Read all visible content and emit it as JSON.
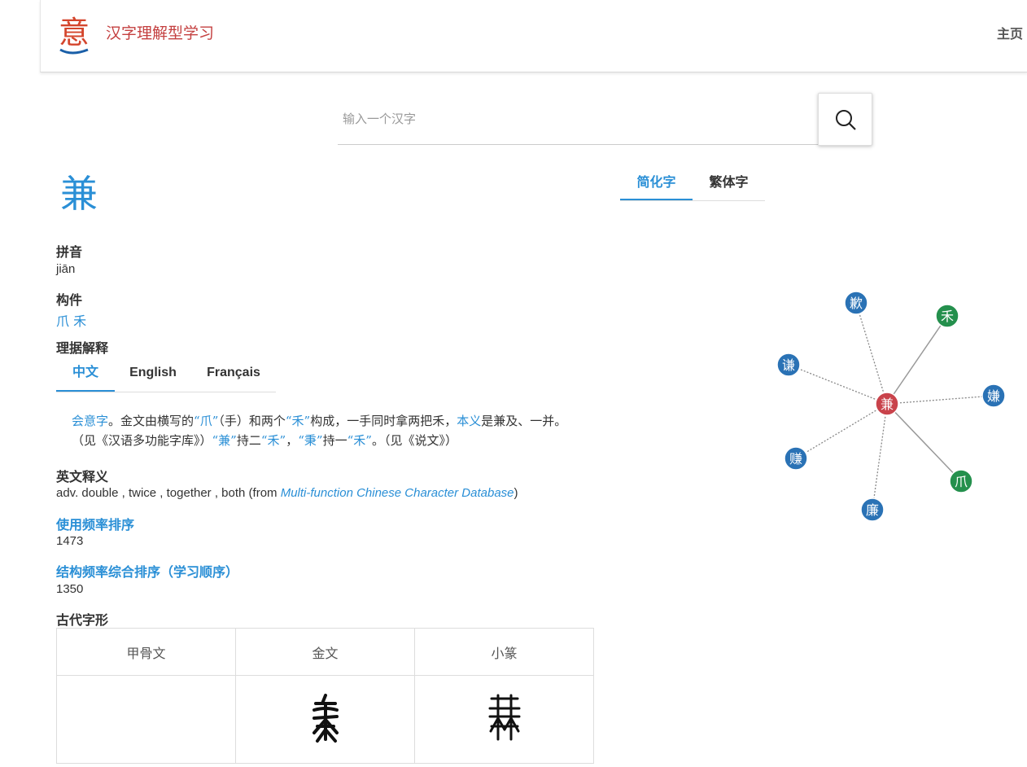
{
  "header": {
    "logo_char": "意",
    "site_title": "汉字理解型学习",
    "home_label": "主页"
  },
  "search": {
    "placeholder": "输入一个汉字"
  },
  "character": {
    "glyph": "兼",
    "pinyin_label": "拼音",
    "pinyin": "jiān",
    "components_label": "构件",
    "components": [
      "爪",
      "禾"
    ],
    "explanation_label": "理据解释",
    "lang_tabs": [
      "中文",
      "English",
      "Français"
    ],
    "explanation": {
      "t1": "会意字",
      "t2": "。金文由横写的",
      "t3": "“爪”",
      "t4": "（手）和两个",
      "t5": "“禾”",
      "t6": "构成，一手同时拿两把禾，",
      "t7": "本义",
      "t8": "是兼及、一并。（见《汉语多功能字库》）",
      "t9": "“兼”",
      "t10": "持二",
      "t11": "“禾”",
      "t12": "，",
      "t13": "“秉”",
      "t14": "持一",
      "t15": "“禾”",
      "t16": "。（见《说文》）"
    },
    "english_label": "英文释义",
    "english_text": "adv. double , twice , together , both (from ",
    "english_source": "Multi-function Chinese Character Database",
    "english_close": ")",
    "freq_label": "使用频率排序",
    "freq_value": "1473",
    "struct_label": "结构频率综合排序（学习顺序）",
    "struct_value": "1350",
    "ancient_label": "古代字形",
    "ancient_headers": [
      "甲骨文",
      "金文",
      "小篆"
    ]
  },
  "script_tabs": [
    "简化字",
    "繁体字"
  ],
  "graph": {
    "center": "兼",
    "components": [
      "禾",
      "爪"
    ],
    "derived": [
      "歉",
      "谦",
      "嫌",
      "赚",
      "廉"
    ],
    "colors": {
      "center": "#c9434b",
      "component": "#24904d",
      "derived": "#2a72b5"
    }
  },
  "colors": {
    "accent": "#2a8fd6",
    "brand": "#c44040"
  }
}
